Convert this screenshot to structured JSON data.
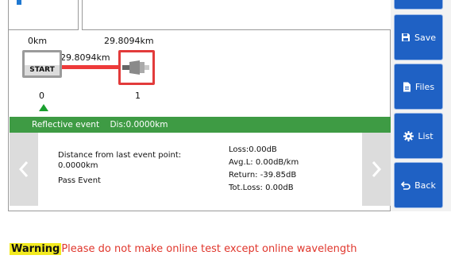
{
  "map": {
    "start_km": "0km",
    "end_km_top": "29.8094km",
    "segment_km": "29.8094km",
    "start_label": "START",
    "start_index": "0",
    "end_index": "1"
  },
  "event_bar": {
    "type": "Reflective event",
    "distance": "Dis:0.0000km"
  },
  "detail": {
    "distance_label": "Distance from last event point:",
    "distance_value": "0.0000km",
    "status": "Pass Event",
    "loss": "Loss:0.00dB",
    "avg_loss": "Avg.L: 0.00dB/km",
    "return_loss": "Return: -39.85dB",
    "total_loss": "Tot.Loss: 0.00dB"
  },
  "sidebar": {
    "save_label": "Save",
    "files_label": "Files",
    "list_label": "List",
    "back_label": "Back"
  },
  "warning": {
    "tag": "Warning",
    "message": "Please do not make online test except online wavelength"
  },
  "colors": {
    "event_bar": "#3e9b44",
    "button_blue": "#1f61c4",
    "fiber_red": "#ee3a3a",
    "warning_text": "#e0362c",
    "warning_highlight": "#f2ea1f"
  },
  "icons": {
    "save": "save-icon",
    "files": "file-icon",
    "list": "gear-icon",
    "back": "back-arrow-icon",
    "prev": "chevron-left-icon",
    "next": "chevron-right-icon",
    "connector": "connector-icon",
    "marker": "triangle-marker-icon"
  }
}
